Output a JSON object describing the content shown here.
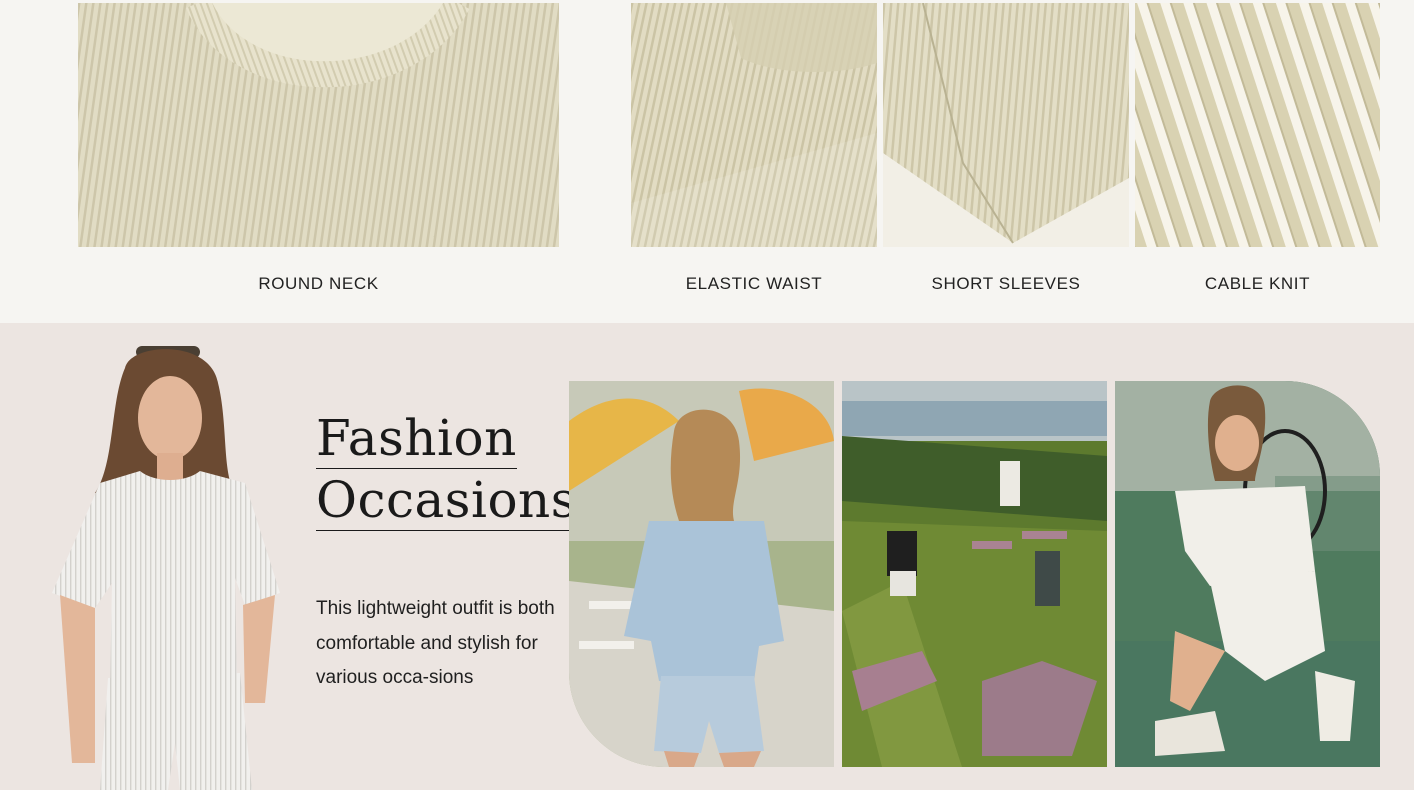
{
  "features": [
    {
      "label": "ROUND NECK",
      "image": "round-neck-closeup"
    },
    {
      "label": "ELASTIC WAIST",
      "image": "elastic-waist-closeup"
    },
    {
      "label": "SHORT SLEEVES",
      "image": "short-sleeve-closeup"
    },
    {
      "label": "CABLE KNIT",
      "image": "cable-knit-closeup"
    }
  ],
  "occasions": {
    "title_line1": "Fashion",
    "title_line2": "Occasions",
    "description": "This lightweight outfit is both comfortable and stylish for various occa-sions",
    "photos": [
      "beach-resort-photo",
      "outdoor-yoga-photo",
      "tennis-court-photo"
    ]
  },
  "colors": {
    "top_background": "#f6f5f2",
    "bottom_background": "#ece5e1",
    "fabric": "#dcd6b8"
  }
}
